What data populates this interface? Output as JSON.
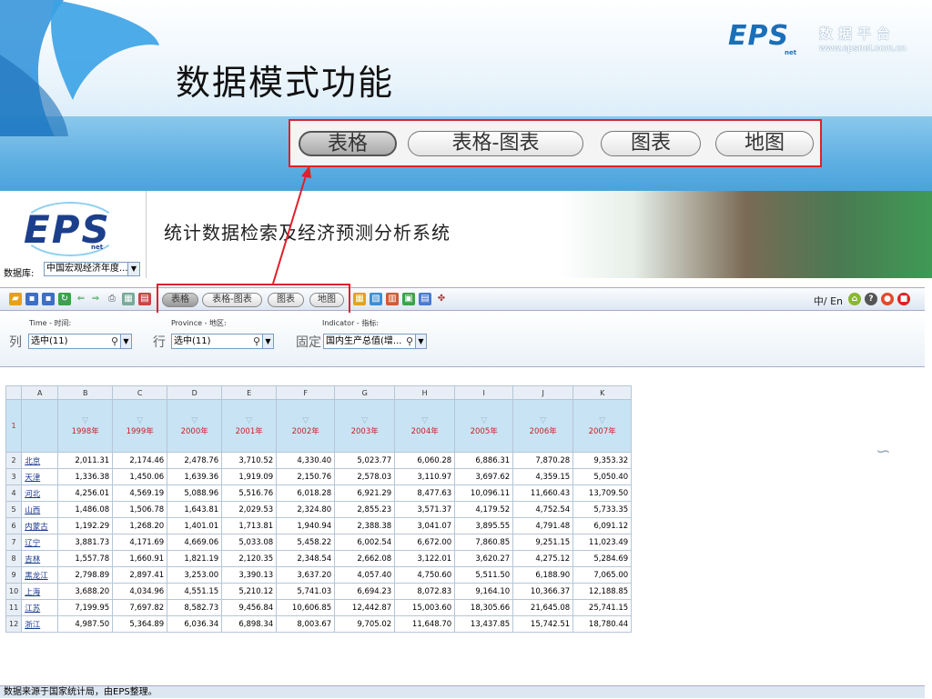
{
  "slide": {
    "title": "数据模式功能",
    "brand": {
      "eps": "EPS",
      "net": "net",
      "cn": "数据平台",
      "url": "www.epsnet.com.cn"
    },
    "modes": [
      "表格",
      "表格-图表",
      "图表",
      "地图"
    ],
    "active_mode": "表格",
    "annotation_color": "#e0202a"
  },
  "app": {
    "logo": "EPS",
    "logo_net": "net",
    "title": "统计数据检索及经济预测分析系统",
    "db_label": "数据库:",
    "db_value": "中国宏观经济年度...",
    "toolbar_modes": [
      "表格",
      "表格-图表",
      "图表",
      "地图"
    ],
    "lang": "中/ En",
    "filters": {
      "col_caption": "Time - 时间:",
      "col_label": "列",
      "col_value": "选中(11)",
      "row_caption": "Province - 地区:",
      "row_label": "行",
      "row_value": "选中(11)",
      "fix_caption": "Indicator - 指标:",
      "fix_label": "固定",
      "fix_value": "国内生产总值(增..."
    },
    "footer": "数据来源于国家统计局，由EPS整理。"
  },
  "table": {
    "col_letters": [
      "A",
      "B",
      "C",
      "D",
      "E",
      "F",
      "G",
      "H",
      "I",
      "J",
      "K"
    ],
    "years": [
      "1998年",
      "1999年",
      "2000年",
      "2001年",
      "2002年",
      "2003年",
      "2004年",
      "2005年",
      "2006年",
      "2007年"
    ],
    "rows": [
      {
        "n": "2",
        "name": "北京",
        "v": [
          "2,011.31",
          "2,174.46",
          "2,478.76",
          "3,710.52",
          "4,330.40",
          "5,023.77",
          "6,060.28",
          "6,886.31",
          "7,870.28",
          "9,353.32"
        ]
      },
      {
        "n": "3",
        "name": "天津",
        "v": [
          "1,336.38",
          "1,450.06",
          "1,639.36",
          "1,919.09",
          "2,150.76",
          "2,578.03",
          "3,110.97",
          "3,697.62",
          "4,359.15",
          "5,050.40"
        ]
      },
      {
        "n": "4",
        "name": "河北",
        "v": [
          "4,256.01",
          "4,569.19",
          "5,088.96",
          "5,516.76",
          "6,018.28",
          "6,921.29",
          "8,477.63",
          "10,096.11",
          "11,660.43",
          "13,709.50"
        ]
      },
      {
        "n": "5",
        "name": "山西",
        "v": [
          "1,486.08",
          "1,506.78",
          "1,643.81",
          "2,029.53",
          "2,324.80",
          "2,855.23",
          "3,571.37",
          "4,179.52",
          "4,752.54",
          "5,733.35"
        ]
      },
      {
        "n": "6",
        "name": "内蒙古",
        "v": [
          "1,192.29",
          "1,268.20",
          "1,401.01",
          "1,713.81",
          "1,940.94",
          "2,388.38",
          "3,041.07",
          "3,895.55",
          "4,791.48",
          "6,091.12"
        ]
      },
      {
        "n": "7",
        "name": "辽宁",
        "v": [
          "3,881.73",
          "4,171.69",
          "4,669.06",
          "5,033.08",
          "5,458.22",
          "6,002.54",
          "6,672.00",
          "7,860.85",
          "9,251.15",
          "11,023.49"
        ]
      },
      {
        "n": "8",
        "name": "吉林",
        "v": [
          "1,557.78",
          "1,660.91",
          "1,821.19",
          "2,120.35",
          "2,348.54",
          "2,662.08",
          "3,122.01",
          "3,620.27",
          "4,275.12",
          "5,284.69"
        ]
      },
      {
        "n": "9",
        "name": "黑龙江",
        "v": [
          "2,798.89",
          "2,897.41",
          "3,253.00",
          "3,390.13",
          "3,637.20",
          "4,057.40",
          "4,750.60",
          "5,511.50",
          "6,188.90",
          "7,065.00"
        ]
      },
      {
        "n": "10",
        "name": "上海",
        "v": [
          "3,688.20",
          "4,034.96",
          "4,551.15",
          "5,210.12",
          "5,741.03",
          "6,694.23",
          "8,072.83",
          "9,164.10",
          "10,366.37",
          "12,188.85"
        ]
      },
      {
        "n": "11",
        "name": "江苏",
        "v": [
          "7,199.95",
          "7,697.82",
          "8,582.73",
          "9,456.84",
          "10,606.85",
          "12,442.87",
          "15,003.60",
          "18,305.66",
          "21,645.08",
          "25,741.15"
        ]
      },
      {
        "n": "12",
        "name": "浙江",
        "v": [
          "4,987.50",
          "5,364.89",
          "6,036.34",
          "6,898.34",
          "8,003.67",
          "9,705.02",
          "11,648.70",
          "13,437.85",
          "15,742.51",
          "18,780.44"
        ]
      }
    ]
  }
}
